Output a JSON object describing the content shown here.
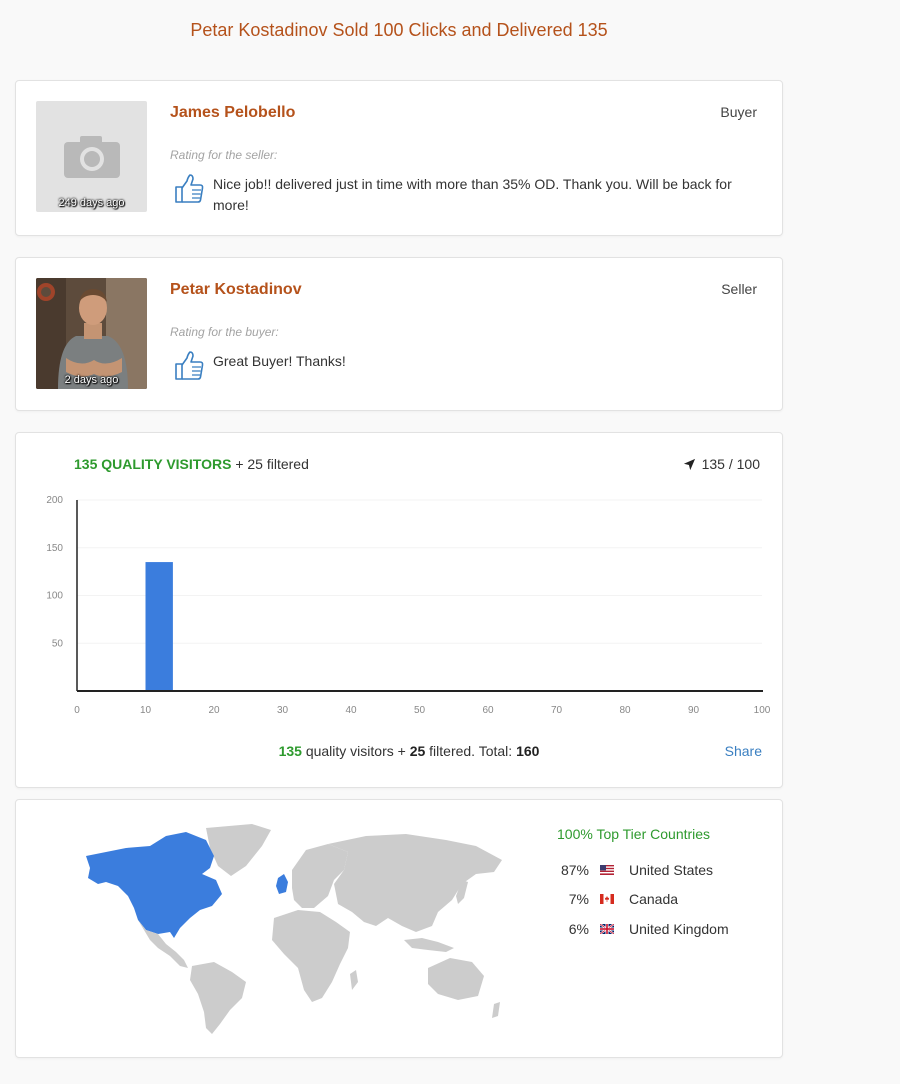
{
  "page": {
    "title": "Petar Kostadinov Sold 100 Clicks and Delivered 135"
  },
  "reviews": [
    {
      "name": "James Pelobello",
      "role": "Buyer",
      "age": "249 days ago",
      "rating_label": "Rating for the seller:",
      "comment": "Nice job!! delivered just in time with more than 35% OD. Thank you. Will be back for more!"
    },
    {
      "name": "Petar Kostadinov",
      "role": "Seller",
      "age": "2 days ago",
      "rating_label": "Rating for the buyer:",
      "comment": "Great Buyer! Thanks!"
    }
  ],
  "stats": {
    "quality_label": "135 QUALITY VISITORS",
    "filtered_label": "+ 25 filtered",
    "progress": "135 / 100",
    "summary": {
      "quality": "135",
      "quality_text": "quality visitors +",
      "filtered": "25",
      "filtered_text": "filtered. Total:",
      "total": "160"
    },
    "share_label": "Share"
  },
  "chart_data": {
    "type": "bar",
    "x": [
      12
    ],
    "values": [
      135
    ],
    "bar_width": 4,
    "xlim": [
      0,
      100
    ],
    "ylim": [
      0,
      200
    ],
    "xticks": [
      "0",
      "10",
      "20",
      "30",
      "40",
      "50",
      "60",
      "70",
      "80",
      "90",
      "100"
    ],
    "yticks": [
      "50",
      "100",
      "150",
      "200"
    ],
    "bar_color": "#3b7ddd",
    "grid": true
  },
  "geo": {
    "heading": "100% Top Tier Countries",
    "countries": [
      {
        "pct": "87%",
        "name": "United States",
        "flag": "us-flag-icon"
      },
      {
        "pct": "7%",
        "name": "Canada",
        "flag": "canada-flag-icon"
      },
      {
        "pct": "6%",
        "name": "United Kingdom",
        "flag": "uk-flag-icon"
      }
    ],
    "highlight_color": "#3b7ddd",
    "land_color": "#cccccc"
  },
  "colors": {
    "accent": "#b5521b",
    "green": "#2e9a2e",
    "link": "#3a7fc1"
  }
}
